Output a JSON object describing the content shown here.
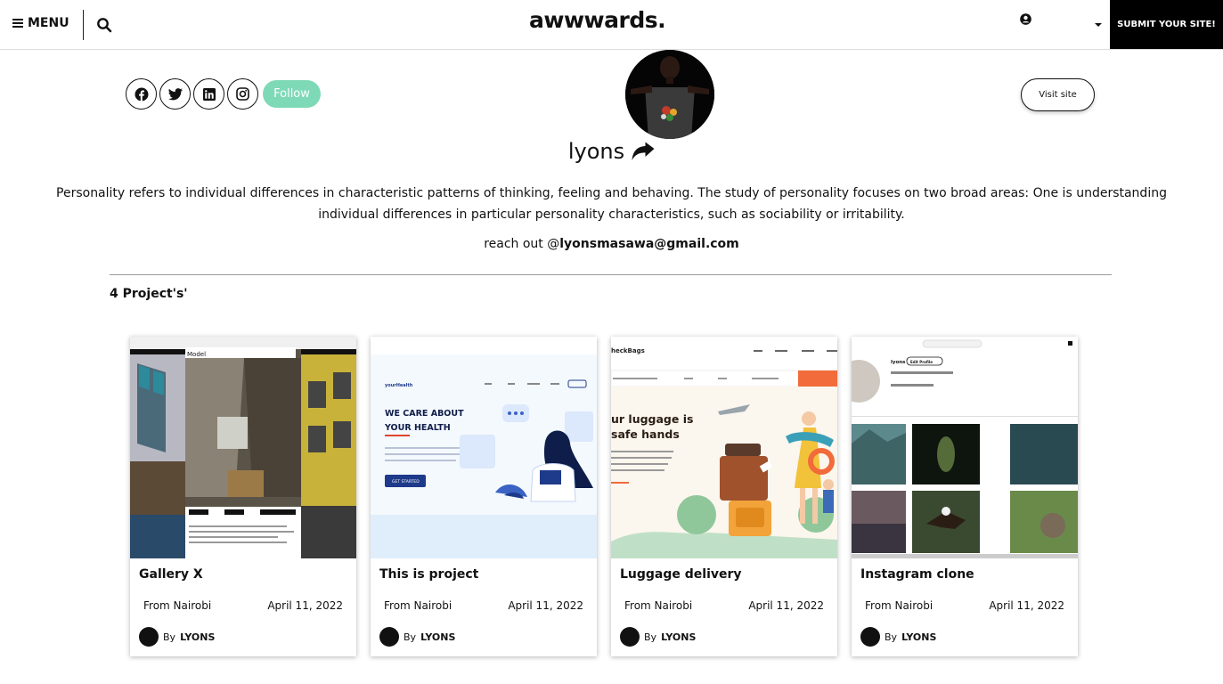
{
  "header": {
    "menu_label": "MENU",
    "logo_text": "awwwards.",
    "submit_label": "SUBMIT YOUR SITE!"
  },
  "profile": {
    "follow_label": "Follow",
    "visit_label": "Visit site",
    "username": "lyons",
    "bio": "Personality refers to individual differences in characteristic patterns of thinking, feeling and behaving. The study of personality focuses on two broad areas: One is understanding individual differences in particular personality characteristics, such as sociability or irritability.",
    "reach_prefix": "reach out @",
    "email": "lyonsmasawa@gmail.com",
    "socials": [
      "facebook-icon",
      "twitter-icon",
      "linkedin-icon",
      "instagram-icon"
    ]
  },
  "projects": {
    "count_label": "4 Project's'",
    "items": [
      {
        "title": "Gallery X",
        "location": "From Nairobi",
        "date": "April 11, 2022",
        "by": "By",
        "author": "LYONS"
      },
      {
        "title": "This is project",
        "location": "From Nairobi",
        "date": "April 11, 2022",
        "by": "By",
        "author": "LYONS"
      },
      {
        "title": "Luggage delivery",
        "location": "From Nairobi",
        "date": "April 11, 2022",
        "by": "By",
        "author": "LYONS"
      },
      {
        "title": "Instagram clone",
        "location": "From Nairobi",
        "date": "April 11, 2022",
        "by": "By",
        "author": "LYONS"
      }
    ]
  },
  "thumbs": {
    "gallery_modal_title": "Model",
    "health_brand": "yourHealth",
    "health_headline_1": "WE CARE ABOUT",
    "health_headline_2": "YOUR HEALTH",
    "health_cta": "GET STARTED",
    "luggage_brand": "heckBags",
    "luggage_headline_1": "ur luggage is",
    "luggage_headline_2": "safe hands",
    "insta_user": "lyons",
    "insta_edit": "Edit Profile"
  },
  "colors": {
    "follow": "#7ed9b7",
    "submit_bg": "#000000"
  }
}
